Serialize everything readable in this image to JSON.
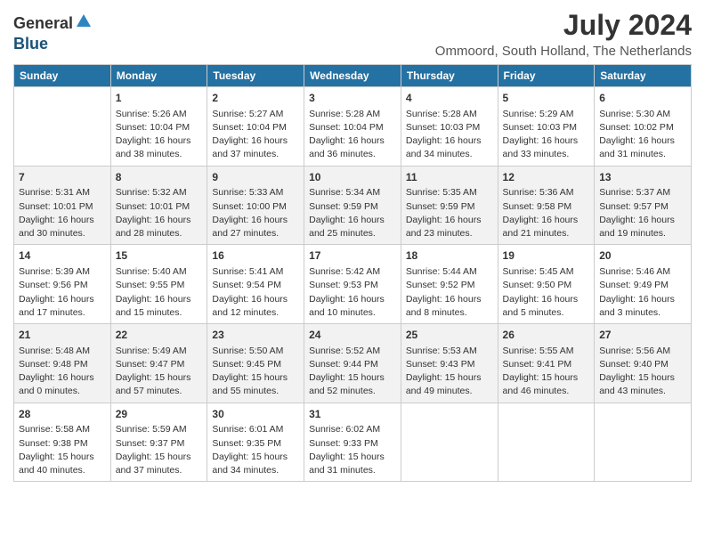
{
  "logo": {
    "general": "General",
    "blue": "Blue"
  },
  "header": {
    "month_year": "July 2024",
    "location": "Ommoord, South Holland, The Netherlands"
  },
  "days_of_week": [
    "Sunday",
    "Monday",
    "Tuesday",
    "Wednesday",
    "Thursday",
    "Friday",
    "Saturday"
  ],
  "weeks": [
    [
      {
        "day": "",
        "info": ""
      },
      {
        "day": "1",
        "info": "Sunrise: 5:26 AM\nSunset: 10:04 PM\nDaylight: 16 hours\nand 38 minutes."
      },
      {
        "day": "2",
        "info": "Sunrise: 5:27 AM\nSunset: 10:04 PM\nDaylight: 16 hours\nand 37 minutes."
      },
      {
        "day": "3",
        "info": "Sunrise: 5:28 AM\nSunset: 10:04 PM\nDaylight: 16 hours\nand 36 minutes."
      },
      {
        "day": "4",
        "info": "Sunrise: 5:28 AM\nSunset: 10:03 PM\nDaylight: 16 hours\nand 34 minutes."
      },
      {
        "day": "5",
        "info": "Sunrise: 5:29 AM\nSunset: 10:03 PM\nDaylight: 16 hours\nand 33 minutes."
      },
      {
        "day": "6",
        "info": "Sunrise: 5:30 AM\nSunset: 10:02 PM\nDaylight: 16 hours\nand 31 minutes."
      }
    ],
    [
      {
        "day": "7",
        "info": "Sunrise: 5:31 AM\nSunset: 10:01 PM\nDaylight: 16 hours\nand 30 minutes."
      },
      {
        "day": "8",
        "info": "Sunrise: 5:32 AM\nSunset: 10:01 PM\nDaylight: 16 hours\nand 28 minutes."
      },
      {
        "day": "9",
        "info": "Sunrise: 5:33 AM\nSunset: 10:00 PM\nDaylight: 16 hours\nand 27 minutes."
      },
      {
        "day": "10",
        "info": "Sunrise: 5:34 AM\nSunset: 9:59 PM\nDaylight: 16 hours\nand 25 minutes."
      },
      {
        "day": "11",
        "info": "Sunrise: 5:35 AM\nSunset: 9:59 PM\nDaylight: 16 hours\nand 23 minutes."
      },
      {
        "day": "12",
        "info": "Sunrise: 5:36 AM\nSunset: 9:58 PM\nDaylight: 16 hours\nand 21 minutes."
      },
      {
        "day": "13",
        "info": "Sunrise: 5:37 AM\nSunset: 9:57 PM\nDaylight: 16 hours\nand 19 minutes."
      }
    ],
    [
      {
        "day": "14",
        "info": "Sunrise: 5:39 AM\nSunset: 9:56 PM\nDaylight: 16 hours\nand 17 minutes."
      },
      {
        "day": "15",
        "info": "Sunrise: 5:40 AM\nSunset: 9:55 PM\nDaylight: 16 hours\nand 15 minutes."
      },
      {
        "day": "16",
        "info": "Sunrise: 5:41 AM\nSunset: 9:54 PM\nDaylight: 16 hours\nand 12 minutes."
      },
      {
        "day": "17",
        "info": "Sunrise: 5:42 AM\nSunset: 9:53 PM\nDaylight: 16 hours\nand 10 minutes."
      },
      {
        "day": "18",
        "info": "Sunrise: 5:44 AM\nSunset: 9:52 PM\nDaylight: 16 hours\nand 8 minutes."
      },
      {
        "day": "19",
        "info": "Sunrise: 5:45 AM\nSunset: 9:50 PM\nDaylight: 16 hours\nand 5 minutes."
      },
      {
        "day": "20",
        "info": "Sunrise: 5:46 AM\nSunset: 9:49 PM\nDaylight: 16 hours\nand 3 minutes."
      }
    ],
    [
      {
        "day": "21",
        "info": "Sunrise: 5:48 AM\nSunset: 9:48 PM\nDaylight: 16 hours\nand 0 minutes."
      },
      {
        "day": "22",
        "info": "Sunrise: 5:49 AM\nSunset: 9:47 PM\nDaylight: 15 hours\nand 57 minutes."
      },
      {
        "day": "23",
        "info": "Sunrise: 5:50 AM\nSunset: 9:45 PM\nDaylight: 15 hours\nand 55 minutes."
      },
      {
        "day": "24",
        "info": "Sunrise: 5:52 AM\nSunset: 9:44 PM\nDaylight: 15 hours\nand 52 minutes."
      },
      {
        "day": "25",
        "info": "Sunrise: 5:53 AM\nSunset: 9:43 PM\nDaylight: 15 hours\nand 49 minutes."
      },
      {
        "day": "26",
        "info": "Sunrise: 5:55 AM\nSunset: 9:41 PM\nDaylight: 15 hours\nand 46 minutes."
      },
      {
        "day": "27",
        "info": "Sunrise: 5:56 AM\nSunset: 9:40 PM\nDaylight: 15 hours\nand 43 minutes."
      }
    ],
    [
      {
        "day": "28",
        "info": "Sunrise: 5:58 AM\nSunset: 9:38 PM\nDaylight: 15 hours\nand 40 minutes."
      },
      {
        "day": "29",
        "info": "Sunrise: 5:59 AM\nSunset: 9:37 PM\nDaylight: 15 hours\nand 37 minutes."
      },
      {
        "day": "30",
        "info": "Sunrise: 6:01 AM\nSunset: 9:35 PM\nDaylight: 15 hours\nand 34 minutes."
      },
      {
        "day": "31",
        "info": "Sunrise: 6:02 AM\nSunset: 9:33 PM\nDaylight: 15 hours\nand 31 minutes."
      },
      {
        "day": "",
        "info": ""
      },
      {
        "day": "",
        "info": ""
      },
      {
        "day": "",
        "info": ""
      }
    ]
  ]
}
